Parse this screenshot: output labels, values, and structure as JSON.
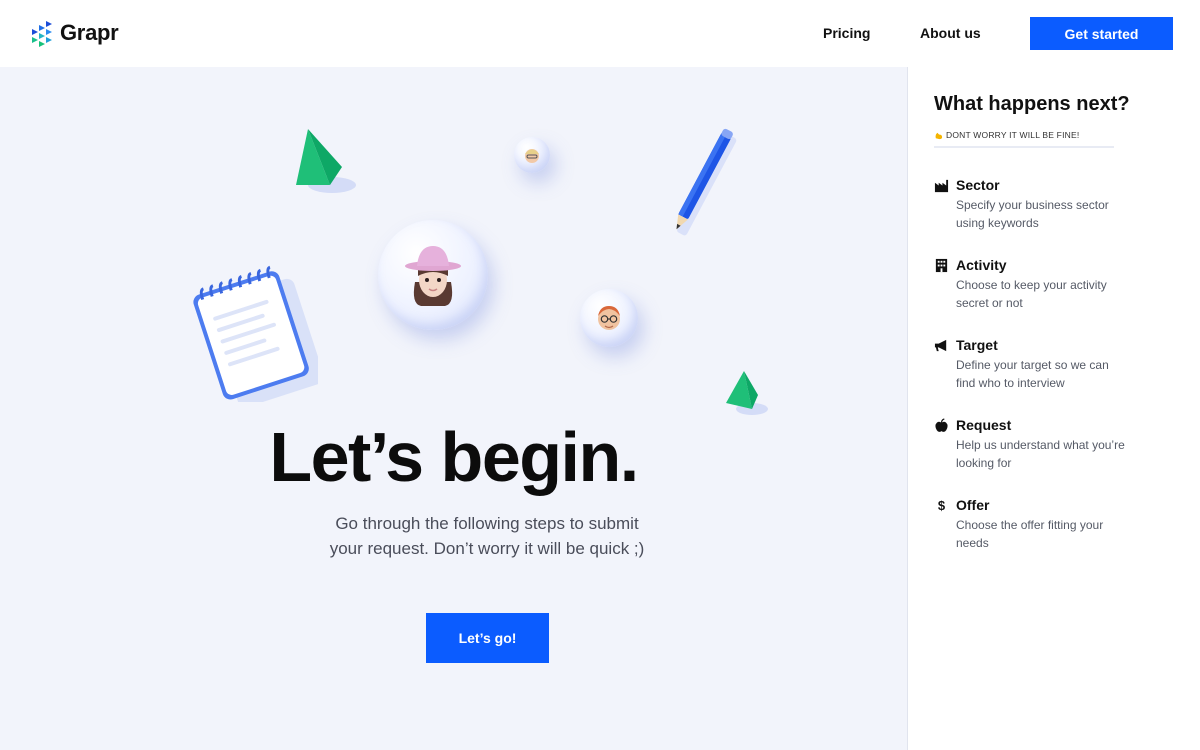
{
  "header": {
    "brand": "Grapr",
    "nav": {
      "pricing": "Pricing",
      "about": "About us"
    },
    "cta": "Get started",
    "accent": "#0b5cff"
  },
  "hero": {
    "headline": "Let’s begin.",
    "subline_1": "Go through the following steps to submit",
    "subline_2": "your request. Don’t worry it will be quick ;)",
    "cta": "Let’s go!"
  },
  "sidebar": {
    "title": "What happens next?",
    "note_icon": "flexed-biceps-icon",
    "note": "DONT WORRY IT WILL BE FINE!",
    "steps": [
      {
        "icon": "factory-icon",
        "title": "Sector",
        "desc": "Specify your business sector using keywords"
      },
      {
        "icon": "building-icon",
        "title": "Activity",
        "desc": "Choose to keep your activity secret or not"
      },
      {
        "icon": "megaphone-icon",
        "title": "Target",
        "desc": "Define your target so we can find who to interview"
      },
      {
        "icon": "apple-icon",
        "title": "Request",
        "desc": "Help us understand what you’re looking for"
      },
      {
        "icon": "dollar-icon",
        "title": "Offer",
        "desc": "Choose the offer fitting your needs"
      }
    ]
  }
}
